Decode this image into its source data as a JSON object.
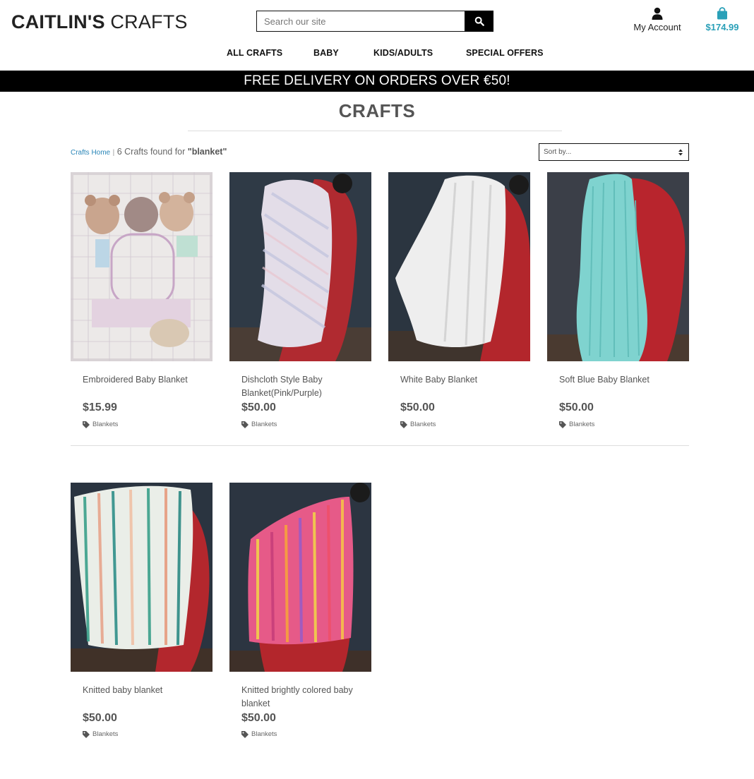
{
  "header": {
    "logo_bold": "CAITLIN'S",
    "logo_light": "CRAFTS",
    "search_placeholder": "Search our site",
    "account_label": "My Account",
    "bag_total": "$174.99"
  },
  "nav": {
    "items": [
      "ALL CRAFTS",
      "BABY",
      "KIDS/ADULTS",
      "SPECIAL OFFERS"
    ]
  },
  "banner": {
    "text": "FREE DELIVERY ON ORDERS OVER €50!"
  },
  "page": {
    "title": "CRAFTS",
    "breadcrumb_home": "Crafts Home",
    "breadcrumb_sep": "|",
    "results_prefix": "6 Crafts found for",
    "results_query": "\"blanket\"",
    "sort_label": "Sort by..."
  },
  "products": [
    {
      "name": "Embroidered Baby Blanket",
      "price": "$15.99",
      "category": "Blankets"
    },
    {
      "name": "Dishcloth Style Baby Blanket(Pink/Purple)",
      "price": "$50.00",
      "category": "Blankets"
    },
    {
      "name": "White Baby Blanket",
      "price": "$50.00",
      "category": "Blankets"
    },
    {
      "name": "Soft Blue Baby Blanket",
      "price": "$50.00",
      "category": "Blankets"
    },
    {
      "name": "Knitted baby blanket",
      "price": "$50.00",
      "category": "Blankets"
    },
    {
      "name": "Knitted brightly colored baby blanket",
      "price": "$50.00",
      "category": "Blankets"
    }
  ],
  "colors": {
    "accent": "#2aa0b8",
    "link": "#2a86b8",
    "banner_bg": "#000000"
  }
}
